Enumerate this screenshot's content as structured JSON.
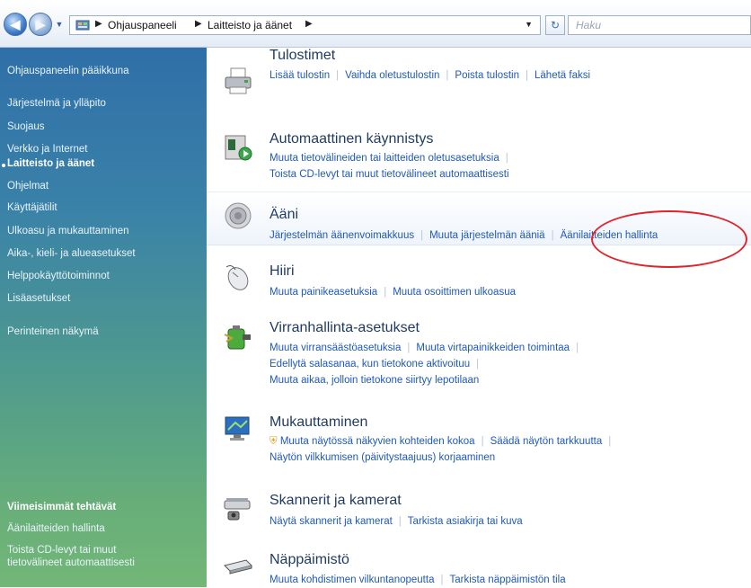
{
  "address_bar": {
    "breadcrumbs": [
      "Ohjauspaneeli",
      "Laitteisto ja äänet"
    ],
    "search_placeholder": "Haku"
  },
  "sidebar": {
    "items": [
      {
        "label": "Ohjauspaneelin pääikkuna"
      },
      {
        "label": "Järjestelmä ja ylläpito"
      },
      {
        "label": "Suojaus"
      },
      {
        "label": "Verkko ja Internet"
      },
      {
        "label": "Laitteisto ja äänet",
        "active": true
      },
      {
        "label": "Ohjelmat"
      },
      {
        "label": "Käyttäjätilit"
      },
      {
        "label": "Ulkoasu ja mukauttaminen"
      },
      {
        "label": "Aika-, kieli- ja alueasetukset"
      },
      {
        "label": "Helppokäyttötoiminnot"
      },
      {
        "label": "Lisäasetukset"
      },
      {
        "label": "Perinteinen näkymä"
      }
    ],
    "recent_title": "Viimeisimmät tehtävät",
    "recent_items": [
      {
        "label": "Äänilaitteiden hallinta"
      },
      {
        "label": "Toista CD-levyt tai muut"
      },
      {
        "label": "tietovälineet automaattisesti"
      }
    ]
  },
  "categories": [
    {
      "title": "Tulostimet",
      "icon": "printer-icon",
      "lines": [
        [
          "Lisää tulostin",
          "Vaihda oletustulostin",
          "Poista tulostin",
          "Lähetä faksi"
        ]
      ]
    },
    {
      "title": "Automaattinen käynnistys",
      "icon": "autoplay-icon",
      "lines": [
        [
          "Muuta tietovälineiden tai laitteiden oletusasetuksia"
        ],
        [
          "Toista CD-levyt tai muut tietovälineet automaattisesti"
        ]
      ]
    },
    {
      "title": "Ääni",
      "icon": "speaker-icon",
      "lines": [
        [
          "Järjestelmän äänenvoimakkuus",
          "Muuta järjestelmän ääniä",
          "Äänilaitteiden hallinta"
        ]
      ]
    },
    {
      "title": "Hiiri",
      "icon": "mouse-icon",
      "lines": [
        [
          "Muuta painikeasetuksia",
          "Muuta osoittimen ulkoasua"
        ]
      ]
    },
    {
      "title": "Virranhallinta-asetukset",
      "icon": "power-icon",
      "lines": [
        [
          "Muuta virransäästöasetuksia",
          "Muuta virtapainikkeiden toimintaa"
        ],
        [
          "Edellytä salasanaa, kun tietokone aktivoituu"
        ],
        [
          "Muuta aikaa, jolloin tietokone siirtyy lepotilaan"
        ]
      ]
    },
    {
      "title": "Mukauttaminen",
      "icon": "monitor-icon",
      "lines": [
        [
          "Muuta näytössä näkyvien kohteiden kokoa",
          "Säädä näytön tarkkuutta"
        ],
        [
          "Näytön vilkkumisen (päivitystaajuus) korjaaminen"
        ]
      ]
    },
    {
      "title": "Skannerit ja kamerat",
      "icon": "scanner-icon",
      "lines": [
        [
          "Näytä skannerit ja kamerat",
          "Tarkista asiakirja tai kuva"
        ]
      ]
    },
    {
      "title": "Näppäimistö",
      "icon": "keyboard-icon",
      "lines": [
        [
          "Muuta kohdistimen vilkuntanopeutta",
          "Tarkista näppäimistön tila"
        ]
      ]
    }
  ],
  "colors": {
    "link": "#1f59b8",
    "title": "#1e3a5f",
    "highlight": "#e0242b"
  }
}
